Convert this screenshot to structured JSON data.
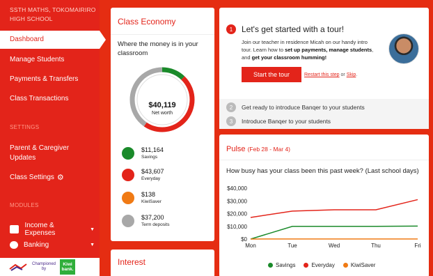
{
  "sidebar": {
    "school": "SSTH MATHS, TOKOMAIRIRO HIGH SCHOOL",
    "nav": [
      {
        "label": "Dashboard"
      },
      {
        "label": "Manage Students"
      },
      {
        "label": "Payments & Transfers"
      },
      {
        "label": "Class Transactions"
      }
    ],
    "settings_head": "SETTINGS",
    "settings": [
      {
        "label": "Parent & Caregiver Updates"
      },
      {
        "label": "Class Settings"
      }
    ],
    "modules_head": "MODULES",
    "modules": [
      {
        "label": "Income & Expenses"
      },
      {
        "label": "Banking"
      }
    ],
    "sponsor": {
      "text1": "Championed",
      "text2": "by",
      "bank": "Kiwi bank."
    }
  },
  "economy": {
    "title": "Class Economy",
    "subtitle": "Where the money is in your classroom",
    "total": "$40,119",
    "total_label": "Net worth",
    "items": [
      {
        "value": "$11,164",
        "name": "Savings",
        "color": "#1a8a2a",
        "amount": 11164
      },
      {
        "value": "$43,607",
        "name": "Everyday",
        "color": "#e3241a",
        "amount": 43607
      },
      {
        "value": "$138",
        "name": "KiwiSaver",
        "color": "#f07a14",
        "amount": 138
      },
      {
        "value": "$37,200",
        "name": "Term deposits",
        "color": "#a8a8a8",
        "amount": 37200
      }
    ]
  },
  "interest": {
    "title": "Interest"
  },
  "tour": {
    "step1_num": "1",
    "title": "Let's get started with a tour!",
    "body_a": "Join our teacher in residence Micah on our handy intro tour. Learn how to ",
    "body_b": "set up payments, manage students",
    "body_c": ", and ",
    "body_d": "get your classroom humming!",
    "start_label": "Start the tour",
    "restart_label": "Restart this step",
    "or": " or ",
    "skip_label": "Skip",
    "dot": ".",
    "steps": [
      {
        "num": "2",
        "text": "Get ready to introduce Banqer to your students"
      },
      {
        "num": "3",
        "text": "Introduce Banqer to your students"
      }
    ]
  },
  "pulse": {
    "title": "Pulse",
    "date": "(Feb 28 - Mar 4)",
    "question": "How busy has your class been this past week? (Last school days)"
  },
  "chart_data": {
    "type": "line",
    "categories": [
      "Mon",
      "Tue",
      "Wed",
      "Thu",
      "Fri"
    ],
    "y_ticks": [
      "$40,000",
      "$30,000",
      "$20,000",
      "$10,000",
      "$0"
    ],
    "ylim": [
      0,
      40000
    ],
    "series": [
      {
        "name": "Savings",
        "color": "#1a8a2a",
        "values": [
          0,
          10000,
          10000,
          10000,
          10200
        ]
      },
      {
        "name": "Everyday",
        "color": "#e3241a",
        "values": [
          17000,
          22000,
          23000,
          23000,
          31000
        ]
      },
      {
        "name": "KiwiSaver",
        "color": "#f07a14",
        "values": [
          0,
          100,
          100,
          100,
          100
        ]
      }
    ]
  }
}
